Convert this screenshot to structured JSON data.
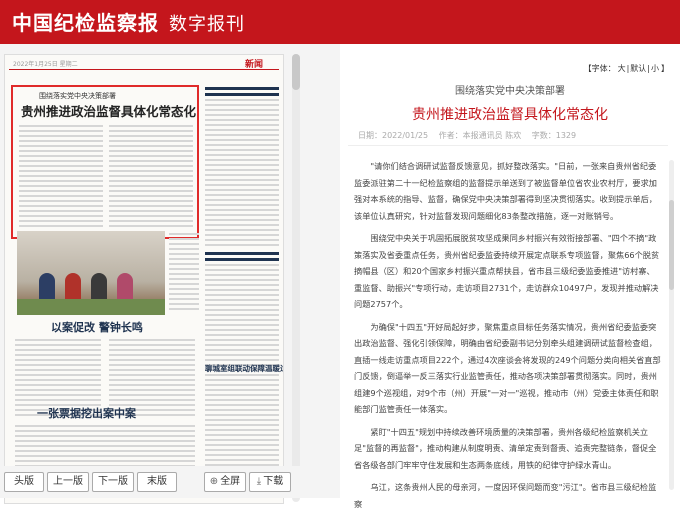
{
  "header": {
    "brand": "中国纪检监察报",
    "subtitle": "数字报刊"
  },
  "newspaper": {
    "masthead_section": "新闻",
    "meta": "2022年1月25日 星期二",
    "highlighted_kicker": "围绕落实党中央决策部署",
    "highlighted_title": "贵州推进政治监督具体化常态化",
    "headline_2": "以案促改 警钟长鸣",
    "headline_3": "一张票据挖出案中案",
    "headline_4": "聊城室组联动保障温暖过冬"
  },
  "toolbar": {
    "first": "头版",
    "prev": "上一版",
    "next": "下一版",
    "last": "末版",
    "full": "全屏",
    "download": "下载",
    "full_icon": "⊕",
    "download_icon": "⤓"
  },
  "font_control": {
    "label": "【字体：",
    "large": "大",
    "default": "默认",
    "small": "小",
    "close": "】"
  },
  "article": {
    "kicker": "围绕落实党中央决策部署",
    "title": "贵州推进政治监督具体化常态化",
    "date": "日期：2022/01/25",
    "author": "作者：本报通讯员 陈欢",
    "views": "字数：1329",
    "paragraphs": [
      "\"请你们结合调研试监督反馈意见，抓好整改落实。\"日前，一张来自贵州省纪委监委派驻第二十一纪检监察组的监督提示单送到了被监督单位省农业农村厅，要求加强对本系统的指导、监督，确保党中央决策部署得到坚决贯彻落实。收到提示单后，该单位认真研究，针对监督发现问题细化83条整改措施，逐一对账销号。",
      "围绕党中央关于巩固拓展脱贫攻坚成果同乡村振兴有效衔接部署、\"四个不摘\"政策落实及省委重点任务，贵州省纪委监委持续开展定点联系专项监督，聚焦66个脱贫摘帽县（区）和20个国家乡村振兴重点帮扶县，省市县三级纪委监委推进\"访村寨、重监督、助振兴\"专项行动，走访项目2731个，走访群众10497户，发现并推动解决问题2757个。",
      "为确保\"十四五\"开好局起好步，聚焦重点目标任务落实情况，贵州省纪委监委突出政治监督、强化引领保障，明确由省纪委副书记分别牵头组建调研试监督检查组，直插一线走访重点项目222个，通过4次座谈会将发现的249个问题分类向相关省直部门反馈，倒逼举一反三落实行业监管责任，推动各项决策部署贯彻落实。同时，贵州组建9个巡视组，对9个市（州）开展\"一对一\"巡视，推动市（州）党委主体责任和职能部门监管责任一体落实。",
      "紧盯\"十四五\"规划中持续改善环境质量的决策部署，贵州各级纪检监察机关立足\"监督的再监督\"，推动构建从制度明责、清单定责到督责、追责完整链条，督促全省各级各部门牢牢守住发展和生态两条底线，用铁的纪律守护绿水青山。",
      "乌江，这条贵州人民的母亲河，一度因环保问题而变\"污江\"。省市县三级纪检监察"
    ]
  },
  "colors": {
    "brand_red": "#c4161c",
    "highlight_border": "#e02a2a",
    "headline_blue": "#1f3350"
  }
}
